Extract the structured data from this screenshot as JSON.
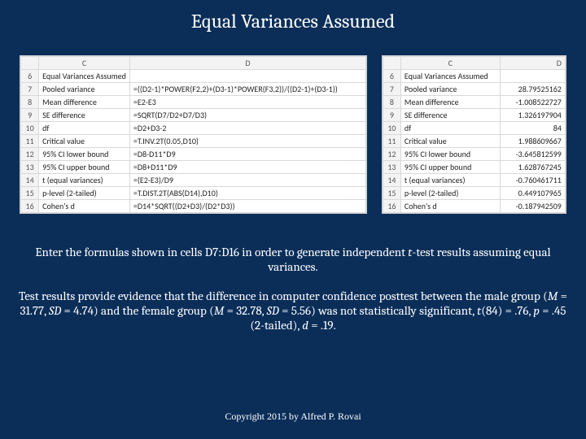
{
  "title": "Equal Variances Assumed",
  "left": {
    "head_c": "C",
    "head_d": "D",
    "rows": [
      {
        "n": "6",
        "c": "Equal Variances Assumed",
        "d": ""
      },
      {
        "n": "7",
        "c": "Pooled variance",
        "d": "=((D2-1)*POWER(F2,2)+(D3-1)*POWER(F3,2))/((D2-1)+(D3-1))"
      },
      {
        "n": "8",
        "c": "Mean difference",
        "d": "=E2-E3"
      },
      {
        "n": "9",
        "c": "SE difference",
        "d": "=SQRT(D7/D2+D7/D3)"
      },
      {
        "n": "10",
        "c": "df",
        "d": "=D2+D3-2"
      },
      {
        "n": "11",
        "c": "Critical value",
        "d": "=T.INV.2T(0.05,D10)"
      },
      {
        "n": "12",
        "c": "95% CI lower bound",
        "d": "=D8-D11*D9"
      },
      {
        "n": "13",
        "c": "95% CI upper bound",
        "d": "=D8+D11*D9"
      },
      {
        "n": "14",
        "c": "t (equal variances)",
        "d": "=(E2-E3)/D9"
      },
      {
        "n": "15",
        "c": "p-level (2-tailed)",
        "d": "=T.DIST.2T(ABS(D14),D10)"
      },
      {
        "n": "16",
        "c": "Cohen's d",
        "d": "=D14*SQRT((D2+D3)/(D2*D3))"
      }
    ]
  },
  "right": {
    "head_c": "C",
    "head_d": "D",
    "rows": [
      {
        "n": "6",
        "c": "Equal Variances Assumed",
        "d": ""
      },
      {
        "n": "7",
        "c": "Pooled variance",
        "d": "28.79525162"
      },
      {
        "n": "8",
        "c": "Mean difference",
        "d": "-1.008522727"
      },
      {
        "n": "9",
        "c": "SE difference",
        "d": "1.326197904"
      },
      {
        "n": "10",
        "c": "df",
        "d": "84"
      },
      {
        "n": "11",
        "c": "Critical value",
        "d": "1.988609667"
      },
      {
        "n": "12",
        "c": "95% CI lower bound",
        "d": "-3.645812599"
      },
      {
        "n": "13",
        "c": "95% CI upper bound",
        "d": "1.628767245"
      },
      {
        "n": "14",
        "c": "t (equal variances)",
        "d": "-0.760461711"
      },
      {
        "n": "15",
        "c": "p-level (2-tailed)",
        "d": "0.449107965"
      },
      {
        "n": "16",
        "c": "Cohen's d",
        "d": "-0.187942509"
      }
    ]
  },
  "para1_a": "Enter the formulas shown in cells D7:D16 in order to generate independent ",
  "para1_b": "t",
  "para1_c": "-test results assuming equal variances.",
  "para2_a": "Test results provide evidence that the difference in computer confidence posttest between the male group (",
  "para2_b": "M",
  "para2_c": " = 31.77, ",
  "para2_d": "SD",
  "para2_e": " = 4.74) and the female group (",
  "para2_f": "M",
  "para2_g": " = 32.78, ",
  "para2_h": "SD",
  "para2_i": " = 5.56) was not statistically significant, ",
  "para2_j": "t",
  "para2_k": "(84) = .76, ",
  "para2_l": "p",
  "para2_m": " = .45 (2-tailed), ",
  "para2_n": "d",
  "para2_o": " = .19.",
  "copyright": "Copyright 2015 by Alfred P. Rovai"
}
